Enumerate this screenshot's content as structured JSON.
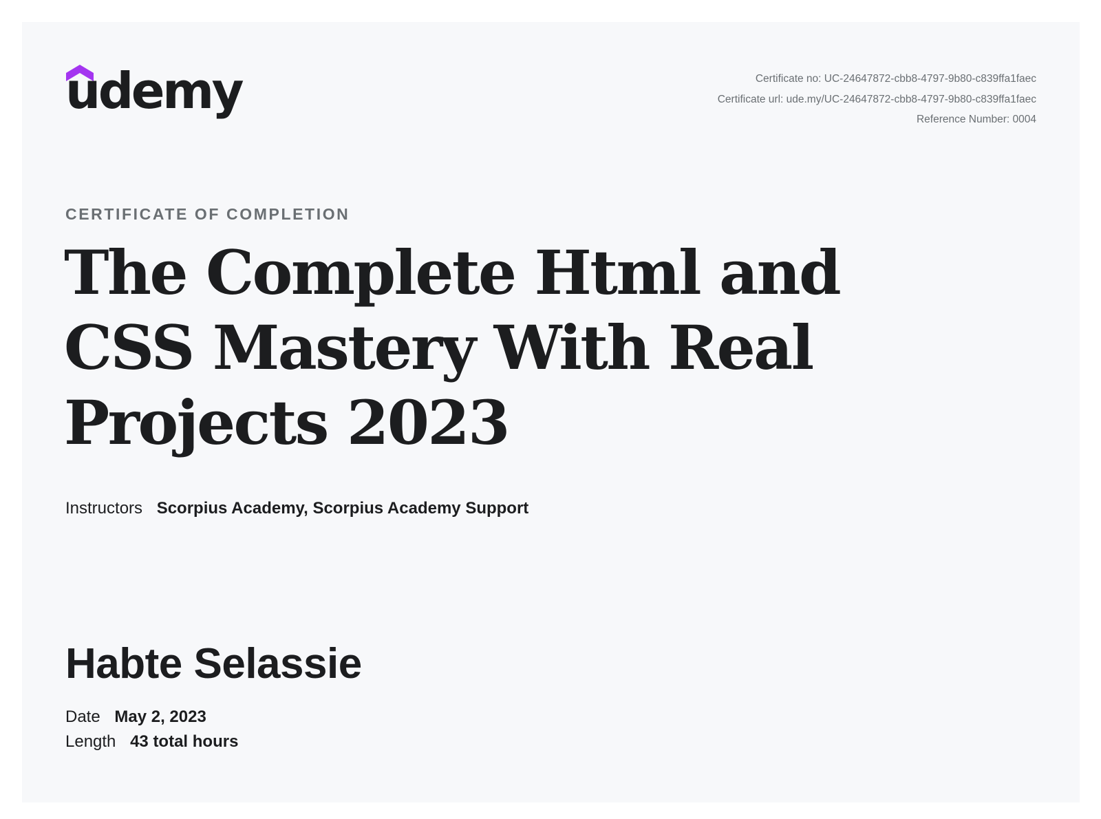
{
  "brand": {
    "name": "udemy",
    "accent_color": "#a435f0",
    "text_color": "#1c1d1f"
  },
  "meta": {
    "certificate_no": "Certificate no: UC-24647872-cbb8-4797-9b80-c839ffa1faec",
    "certificate_url": "Certificate url: ude.my/UC-24647872-cbb8-4797-9b80-c839ffa1faec",
    "reference_number": "Reference Number: 0004"
  },
  "eyebrow": "CERTIFICATE OF COMPLETION",
  "course_title": "The Complete Html and CSS Mastery With Real Projects 2023",
  "instructors": {
    "label": "Instructors",
    "names": [
      "Scorpius Academy,",
      "Scorpius Academy Support"
    ]
  },
  "recipient": "Habte Selassie",
  "date": {
    "label": "Date",
    "value": "May 2, 2023"
  },
  "length": {
    "label": "Length",
    "value": "43 total hours"
  },
  "colors": {
    "page_background": "#f7f8fa",
    "muted_text": "#6a6f73"
  }
}
